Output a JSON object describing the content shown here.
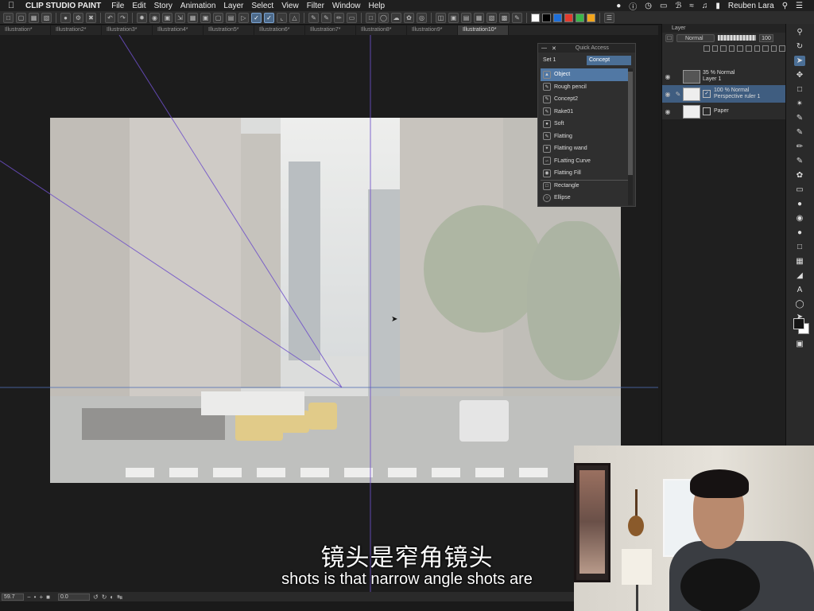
{
  "menubar": {
    "app_name": "CLIP STUDIO PAINT",
    "items": [
      "File",
      "Edit",
      "Story",
      "Animation",
      "Layer",
      "Select",
      "View",
      "Filter",
      "Window",
      "Help"
    ],
    "user": "Reuben Lara"
  },
  "toolbar": {
    "colors": [
      "#ffffff",
      "#000000",
      "#1e6fd9",
      "#e23b2e",
      "#3bb54a",
      "#f2a51c"
    ]
  },
  "tabs": [
    "Illustration*",
    "Illustration2*",
    "Illustration3*",
    "Illustration4*",
    "Illustration5*",
    "Illustration6*",
    "Illustration7*",
    "Illustration8*",
    "Illustration9*",
    "Illustration10*"
  ],
  "active_tab": "Illustration10*",
  "quick_access": {
    "title": "Quick Access",
    "sets": [
      "Set 1",
      "Concept"
    ],
    "active_set": "Concept",
    "items": [
      {
        "label": "Object",
        "icon": "object-icon"
      },
      {
        "label": "Rough pencil",
        "icon": "pencil-icon"
      },
      {
        "label": "Concept2",
        "icon": "pencil-icon"
      },
      {
        "label": "Rake01",
        "icon": "pencil-icon"
      },
      {
        "label": "Soft",
        "icon": "airbrush-icon"
      },
      {
        "label": "Flatting",
        "icon": "pencil-icon"
      },
      {
        "label": "Flatting wand",
        "icon": "wand-icon"
      },
      {
        "label": "FLatting Curve",
        "icon": "curve-icon"
      },
      {
        "label": "Flatting Fill",
        "icon": "fill-icon"
      },
      {
        "label": "Rectangle",
        "icon": "rectangle-icon"
      },
      {
        "label": "Ellipse",
        "icon": "ellipse-icon"
      }
    ],
    "selected": "Object"
  },
  "layer_panel": {
    "title": "Layer",
    "blend_mode": "Normal",
    "opacity": "100",
    "layers": [
      {
        "line1": "35 % Normal",
        "line2": "Layer 1",
        "selected": false
      },
      {
        "line1": "100 % Normal",
        "line2": "Perspective ruler 1",
        "selected": true
      },
      {
        "line1": "",
        "line2": "Paper",
        "selected": false
      }
    ]
  },
  "status_bar": {
    "zoom": "59.7",
    "angle": "0.0"
  },
  "subtitles": {
    "chinese": "镜头是窄角镜头",
    "english": "shots is that narrow angle shots are"
  }
}
